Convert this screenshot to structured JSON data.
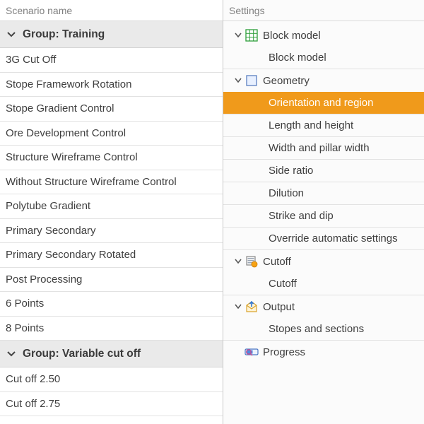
{
  "left": {
    "header": "Scenario name",
    "groups": [
      {
        "label": "Group: Training",
        "items": [
          "3G Cut Off",
          "Stope Framework Rotation",
          "Stope Gradient Control",
          "Ore Development Control",
          "Structure Wireframe Control",
          "Without Structure Wireframe Control",
          "Polytube Gradient",
          "Primary Secondary",
          "Primary Secondary Rotated",
          "Post Processing",
          "6 Points",
          "8 Points"
        ]
      },
      {
        "label": "Group: Variable cut off",
        "items": [
          "Cut off 2.50",
          "Cut off 2.75"
        ]
      }
    ]
  },
  "right": {
    "header": "Settings",
    "tree": [
      {
        "icon": "block-model-icon",
        "label": "Block model",
        "expanded": true,
        "children": [
          {
            "label": "Block model",
            "selected": false
          }
        ]
      },
      {
        "icon": "geometry-icon",
        "label": "Geometry",
        "expanded": true,
        "children": [
          {
            "label": "Orientation and region",
            "selected": true
          },
          {
            "label": "Length and height",
            "selected": false
          },
          {
            "label": "Width and pillar width",
            "selected": false
          },
          {
            "label": "Side ratio",
            "selected": false
          },
          {
            "label": "Dilution",
            "selected": false
          },
          {
            "label": "Strike and dip",
            "selected": false
          },
          {
            "label": "Override automatic settings",
            "selected": false
          }
        ]
      },
      {
        "icon": "cutoff-icon",
        "label": "Cutoff",
        "expanded": true,
        "children": [
          {
            "label": "Cutoff",
            "selected": false
          }
        ]
      },
      {
        "icon": "output-icon",
        "label": "Output",
        "expanded": true,
        "children": [
          {
            "label": "Stopes and sections",
            "selected": false
          }
        ]
      },
      {
        "icon": "progress-icon",
        "label": "Progress",
        "expanded": false,
        "children": []
      }
    ]
  },
  "colors": {
    "selection": "#f09a1b"
  }
}
